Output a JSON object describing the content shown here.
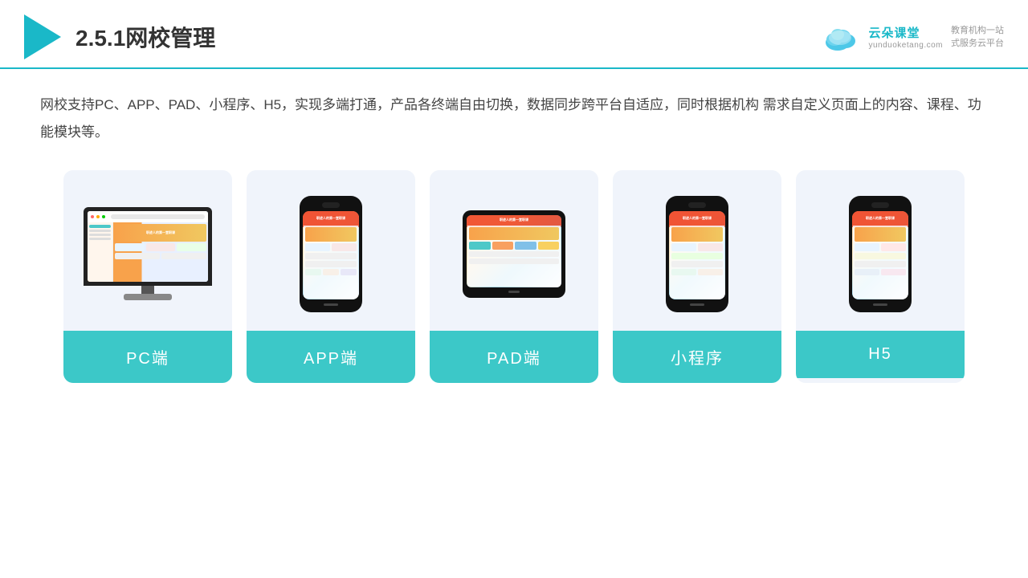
{
  "header": {
    "title": "2.5.1网校管理",
    "brand": {
      "name": "云朵课堂",
      "domain": "yunduoketang.com",
      "slogan": "教育机构一站\n式服务云平台"
    }
  },
  "description": "网校支持PC、APP、PAD、小程序、H5，实现多端打通，产品各终端自由切换，数据同步跨平台自适应，同时根据机构\n需求自定义页面上的内容、课程、功能模块等。",
  "cards": [
    {
      "id": "pc",
      "label": "PC端",
      "type": "pc"
    },
    {
      "id": "app",
      "label": "APP端",
      "type": "phone"
    },
    {
      "id": "pad",
      "label": "PAD端",
      "type": "tablet"
    },
    {
      "id": "mini",
      "label": "小程序",
      "type": "phone"
    },
    {
      "id": "h5",
      "label": "H5",
      "type": "phone"
    }
  ],
  "colors": {
    "accent": "#3cc8c8",
    "bg": "#f0f4fb",
    "title": "#333",
    "text": "#444"
  }
}
